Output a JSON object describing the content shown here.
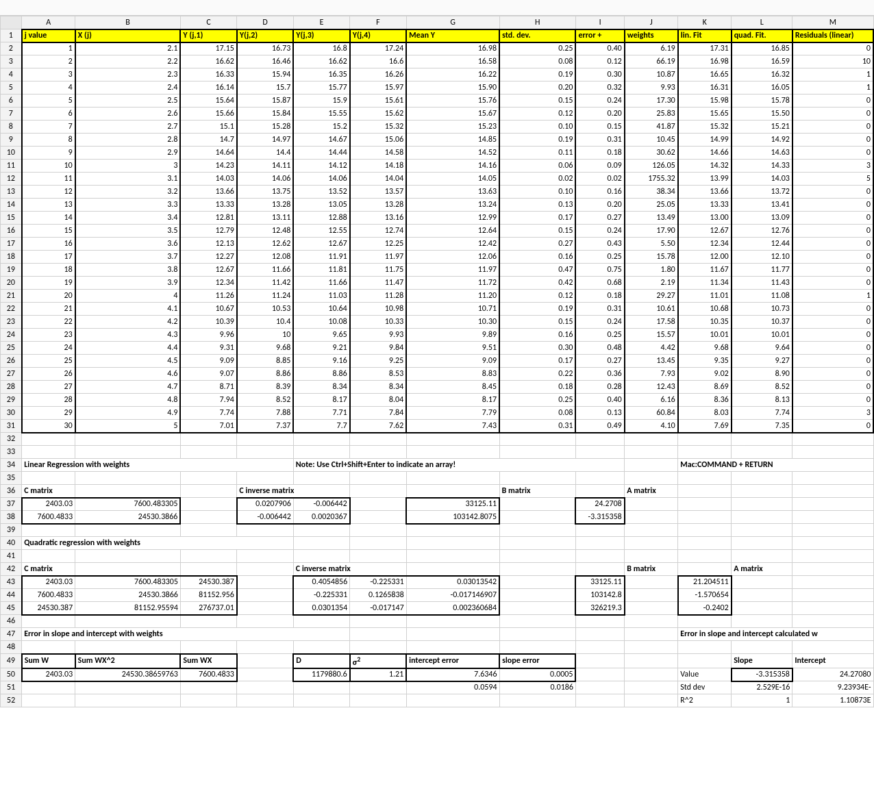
{
  "colHeaders": [
    "A",
    "B",
    "C",
    "D",
    "E",
    "F",
    "G",
    "H",
    "I",
    "J",
    "K",
    "L",
    "M"
  ],
  "headerRow": {
    "A": "j value",
    "B": "X (j)",
    "C": "Y (j,1)",
    "D": "Y(j,2)",
    "E": "Y(j,3)",
    "F": "Y(j,4)",
    "G": "Mean Y",
    "H": "std. dev.",
    "I": "error +",
    "J": "weights",
    "K": "lin. Fit",
    "L": "quad. Fit.",
    "M": "Residuals (linear)"
  },
  "dataRows": [
    {
      "j": "1",
      "x": "2.1",
      "y1": "17.15",
      "y2": "16.73",
      "y3": "16.8",
      "y4": "17.24",
      "mean": "16.98",
      "sd": "0.25",
      "err": "0.40",
      "w": "6.19",
      "lin": "17.31",
      "quad": "16.85",
      "res": "0"
    },
    {
      "j": "2",
      "x": "2.2",
      "y1": "16.62",
      "y2": "16.46",
      "y3": "16.62",
      "y4": "16.6",
      "mean": "16.58",
      "sd": "0.08",
      "err": "0.12",
      "w": "66.19",
      "lin": "16.98",
      "quad": "16.59",
      "res": "10"
    },
    {
      "j": "3",
      "x": "2.3",
      "y1": "16.33",
      "y2": "15.94",
      "y3": "16.35",
      "y4": "16.26",
      "mean": "16.22",
      "sd": "0.19",
      "err": "0.30",
      "w": "10.87",
      "lin": "16.65",
      "quad": "16.32",
      "res": "1"
    },
    {
      "j": "4",
      "x": "2.4",
      "y1": "16.14",
      "y2": "15.7",
      "y3": "15.77",
      "y4": "15.97",
      "mean": "15.90",
      "sd": "0.20",
      "err": "0.32",
      "w": "9.93",
      "lin": "16.31",
      "quad": "16.05",
      "res": "1"
    },
    {
      "j": "5",
      "x": "2.5",
      "y1": "15.64",
      "y2": "15.87",
      "y3": "15.9",
      "y4": "15.61",
      "mean": "15.76",
      "sd": "0.15",
      "err": "0.24",
      "w": "17.30",
      "lin": "15.98",
      "quad": "15.78",
      "res": "0"
    },
    {
      "j": "6",
      "x": "2.6",
      "y1": "15.66",
      "y2": "15.84",
      "y3": "15.55",
      "y4": "15.62",
      "mean": "15.67",
      "sd": "0.12",
      "err": "0.20",
      "w": "25.83",
      "lin": "15.65",
      "quad": "15.50",
      "res": "0"
    },
    {
      "j": "7",
      "x": "2.7",
      "y1": "15.1",
      "y2": "15.28",
      "y3": "15.2",
      "y4": "15.32",
      "mean": "15.23",
      "sd": "0.10",
      "err": "0.15",
      "w": "41.87",
      "lin": "15.32",
      "quad": "15.21",
      "res": "0"
    },
    {
      "j": "8",
      "x": "2.8",
      "y1": "14.7",
      "y2": "14.97",
      "y3": "14.67",
      "y4": "15.06",
      "mean": "14.85",
      "sd": "0.19",
      "err": "0.31",
      "w": "10.45",
      "lin": "14.99",
      "quad": "14.92",
      "res": "0"
    },
    {
      "j": "9",
      "x": "2.9",
      "y1": "14.64",
      "y2": "14.4",
      "y3": "14.44",
      "y4": "14.58",
      "mean": "14.52",
      "sd": "0.11",
      "err": "0.18",
      "w": "30.62",
      "lin": "14.66",
      "quad": "14.63",
      "res": "0"
    },
    {
      "j": "10",
      "x": "3",
      "y1": "14.23",
      "y2": "14.11",
      "y3": "14.12",
      "y4": "14.18",
      "mean": "14.16",
      "sd": "0.06",
      "err": "0.09",
      "w": "126.05",
      "lin": "14.32",
      "quad": "14.33",
      "res": "3"
    },
    {
      "j": "11",
      "x": "3.1",
      "y1": "14.03",
      "y2": "14.06",
      "y3": "14.06",
      "y4": "14.04",
      "mean": "14.05",
      "sd": "0.02",
      "err": "0.02",
      "w": "1755.32",
      "lin": "13.99",
      "quad": "14.03",
      "res": "5"
    },
    {
      "j": "12",
      "x": "3.2",
      "y1": "13.66",
      "y2": "13.75",
      "y3": "13.52",
      "y4": "13.57",
      "mean": "13.63",
      "sd": "0.10",
      "err": "0.16",
      "w": "38.34",
      "lin": "13.66",
      "quad": "13.72",
      "res": "0"
    },
    {
      "j": "13",
      "x": "3.3",
      "y1": "13.33",
      "y2": "13.28",
      "y3": "13.05",
      "y4": "13.28",
      "mean": "13.24",
      "sd": "0.13",
      "err": "0.20",
      "w": "25.05",
      "lin": "13.33",
      "quad": "13.41",
      "res": "0"
    },
    {
      "j": "14",
      "x": "3.4",
      "y1": "12.81",
      "y2": "13.11",
      "y3": "12.88",
      "y4": "13.16",
      "mean": "12.99",
      "sd": "0.17",
      "err": "0.27",
      "w": "13.49",
      "lin": "13.00",
      "quad": "13.09",
      "res": "0"
    },
    {
      "j": "15",
      "x": "3.5",
      "y1": "12.79",
      "y2": "12.48",
      "y3": "12.55",
      "y4": "12.74",
      "mean": "12.64",
      "sd": "0.15",
      "err": "0.24",
      "w": "17.90",
      "lin": "12.67",
      "quad": "12.76",
      "res": "0"
    },
    {
      "j": "16",
      "x": "3.6",
      "y1": "12.13",
      "y2": "12.62",
      "y3": "12.67",
      "y4": "12.25",
      "mean": "12.42",
      "sd": "0.27",
      "err": "0.43",
      "w": "5.50",
      "lin": "12.34",
      "quad": "12.44",
      "res": "0"
    },
    {
      "j": "17",
      "x": "3.7",
      "y1": "12.27",
      "y2": "12.08",
      "y3": "11.91",
      "y4": "11.97",
      "mean": "12.06",
      "sd": "0.16",
      "err": "0.25",
      "w": "15.78",
      "lin": "12.00",
      "quad": "12.10",
      "res": "0"
    },
    {
      "j": "18",
      "x": "3.8",
      "y1": "12.67",
      "y2": "11.66",
      "y3": "11.81",
      "y4": "11.75",
      "mean": "11.97",
      "sd": "0.47",
      "err": "0.75",
      "w": "1.80",
      "lin": "11.67",
      "quad": "11.77",
      "res": "0"
    },
    {
      "j": "19",
      "x": "3.9",
      "y1": "12.34",
      "y2": "11.42",
      "y3": "11.66",
      "y4": "11.47",
      "mean": "11.72",
      "sd": "0.42",
      "err": "0.68",
      "w": "2.19",
      "lin": "11.34",
      "quad": "11.43",
      "res": "0"
    },
    {
      "j": "20",
      "x": "4",
      "y1": "11.26",
      "y2": "11.24",
      "y3": "11.03",
      "y4": "11.28",
      "mean": "11.20",
      "sd": "0.12",
      "err": "0.18",
      "w": "29.27",
      "lin": "11.01",
      "quad": "11.08",
      "res": "1"
    },
    {
      "j": "21",
      "x": "4.1",
      "y1": "10.67",
      "y2": "10.53",
      "y3": "10.64",
      "y4": "10.98",
      "mean": "10.71",
      "sd": "0.19",
      "err": "0.31",
      "w": "10.61",
      "lin": "10.68",
      "quad": "10.73",
      "res": "0"
    },
    {
      "j": "22",
      "x": "4.2",
      "y1": "10.39",
      "y2": "10.4",
      "y3": "10.08",
      "y4": "10.33",
      "mean": "10.30",
      "sd": "0.15",
      "err": "0.24",
      "w": "17.58",
      "lin": "10.35",
      "quad": "10.37",
      "res": "0"
    },
    {
      "j": "23",
      "x": "4.3",
      "y1": "9.96",
      "y2": "10",
      "y3": "9.65",
      "y4": "9.93",
      "mean": "9.89",
      "sd": "0.16",
      "err": "0.25",
      "w": "15.57",
      "lin": "10.01",
      "quad": "10.01",
      "res": "0"
    },
    {
      "j": "24",
      "x": "4.4",
      "y1": "9.31",
      "y2": "9.68",
      "y3": "9.21",
      "y4": "9.84",
      "mean": "9.51",
      "sd": "0.30",
      "err": "0.48",
      "w": "4.42",
      "lin": "9.68",
      "quad": "9.64",
      "res": "0"
    },
    {
      "j": "25",
      "x": "4.5",
      "y1": "9.09",
      "y2": "8.85",
      "y3": "9.16",
      "y4": "9.25",
      "mean": "9.09",
      "sd": "0.17",
      "err": "0.27",
      "w": "13.45",
      "lin": "9.35",
      "quad": "9.27",
      "res": "0"
    },
    {
      "j": "26",
      "x": "4.6",
      "y1": "9.07",
      "y2": "8.86",
      "y3": "8.86",
      "y4": "8.53",
      "mean": "8.83",
      "sd": "0.22",
      "err": "0.36",
      "w": "7.93",
      "lin": "9.02",
      "quad": "8.90",
      "res": "0"
    },
    {
      "j": "27",
      "x": "4.7",
      "y1": "8.71",
      "y2": "8.39",
      "y3": "8.34",
      "y4": "8.34",
      "mean": "8.45",
      "sd": "0.18",
      "err": "0.28",
      "w": "12.43",
      "lin": "8.69",
      "quad": "8.52",
      "res": "0"
    },
    {
      "j": "28",
      "x": "4.8",
      "y1": "7.94",
      "y2": "8.52",
      "y3": "8.17",
      "y4": "8.04",
      "mean": "8.17",
      "sd": "0.25",
      "err": "0.40",
      "w": "6.16",
      "lin": "8.36",
      "quad": "8.13",
      "res": "0"
    },
    {
      "j": "29",
      "x": "4.9",
      "y1": "7.74",
      "y2": "7.88",
      "y3": "7.71",
      "y4": "7.84",
      "mean": "7.79",
      "sd": "0.08",
      "err": "0.13",
      "w": "60.84",
      "lin": "8.03",
      "quad": "7.74",
      "res": "3"
    },
    {
      "j": "30",
      "x": "5",
      "y1": "7.01",
      "y2": "7.37",
      "y3": "7.7",
      "y4": "7.62",
      "mean": "7.43",
      "sd": "0.31",
      "err": "0.49",
      "w": "4.10",
      "lin": "7.69",
      "quad": "7.35",
      "res": "0"
    }
  ],
  "labels": {
    "linReg": "Linear Regression with weights",
    "note": "Note:  Use Ctrl+Shift+Enter to indicate an array!",
    "mac": "Mac:COMMAND + RETURN",
    "cmat": "C matrix",
    "cinv": "C inverse matrix",
    "bmat": "B matrix",
    "amat": "A matrix",
    "quadReg": "Quadratic regression with weights",
    "errSlope": "Error in slope and intercept with weights",
    "errCalc": "Error in slope and intercept calculated w",
    "sumW": "Sum W",
    "sumWX2": "Sum WX^2",
    "sumWX": "Sum WX",
    "D": "D",
    "sigma": "σ²",
    "intErr": "intercept error",
    "slopeErr": "slope error",
    "slope": "Slope",
    "intercept": "Intercept",
    "value": "Value",
    "stdDev": "Std dev",
    "r2": "R^2"
  },
  "linC": {
    "r1": {
      "a": "2403.03",
      "b": "7600.483305"
    },
    "r2": {
      "a": "7600.4833",
      "b": "24530.3866"
    }
  },
  "linCinv": {
    "r1": {
      "a": "0.0207906",
      "b": "-0.006442"
    },
    "r2": {
      "a": "-0.006442",
      "b": "0.0020367"
    }
  },
  "linB": {
    "a": "33125.11",
    "b": "103142.8075"
  },
  "linA": {
    "a": "24.2708",
    "b": "-3.315358"
  },
  "quadC": {
    "r1": {
      "a": "2403.03",
      "b": "7600.483305",
      "c": "24530.387"
    },
    "r2": {
      "a": "7600.4833",
      "b": "24530.3866",
      "c": "81152.956"
    },
    "r3": {
      "a": "24530.387",
      "b": "81152.95594",
      "c": "276737.01"
    }
  },
  "quadCinv": {
    "r1": {
      "a": "0.4054856",
      "b": "-0.225331",
      "c": "0.03013542"
    },
    "r2": {
      "a": "-0.225331",
      "b": "0.1265838",
      "c": "-0.017146907"
    },
    "r3": {
      "a": "0.0301354",
      "b": "-0.017147",
      "c": "0.002360684"
    }
  },
  "quadB": {
    "a": "33125.11",
    "b": "103142.8",
    "c": "326219.3"
  },
  "quadA": {
    "a": "21.204511",
    "b": "-1.570654",
    "c": "-0.2402"
  },
  "err": {
    "sumW": "2403.03",
    "sumWX2": "24530.38659763",
    "sumWX": "7600.4833",
    "D": "1179880.6",
    "sigma": "1.21",
    "intErr1": "7.6346",
    "slopeErr1": "0.0005",
    "intErr2": "0.0594",
    "slopeErr2": "0.0186",
    "slopeVal": "-3.315358",
    "intVal": "24.27080",
    "slopeSd": "2.529E-16",
    "intSd": "9.23934E-",
    "r2a": "1",
    "r2b": "1.10873E"
  }
}
